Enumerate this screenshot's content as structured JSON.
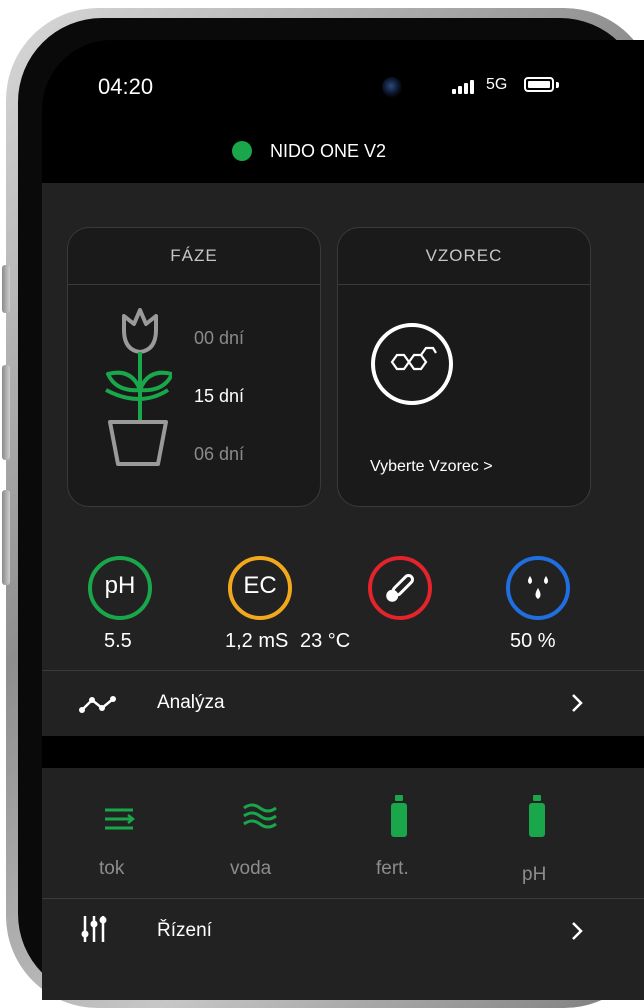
{
  "status_bar": {
    "time": "04:20",
    "network": "5G"
  },
  "device": {
    "name": "NIDO ONE V2",
    "status_color": "#1aa64a"
  },
  "phase_card": {
    "title": "FÁZE",
    "days": [
      "00 dní",
      "15 dní",
      "06 dní"
    ]
  },
  "formula_card": {
    "title": "VZOREC",
    "action": "Vyberte Vzorec >"
  },
  "sensors": [
    {
      "icon": "ph-icon",
      "label": "pH",
      "value": "5.5",
      "color": "#1aa64a"
    },
    {
      "icon": "ec-icon",
      "label": "EC",
      "value": "1,2 mS",
      "color": "#f2a81d"
    },
    {
      "icon": "thermometer-icon",
      "value": "23 °C",
      "color": "#e3242b"
    },
    {
      "icon": "humidity-icon",
      "value": "50 %",
      "color": "#1f6fe0"
    }
  ],
  "analysis": {
    "label": "Analýza"
  },
  "controls": [
    {
      "icon": "flow-icon",
      "label": "tok"
    },
    {
      "icon": "water-icon",
      "label": "voda"
    },
    {
      "icon": "fertilizer-bottle-icon",
      "label": "fert."
    },
    {
      "icon": "ph-bottle-icon",
      "label": "pH"
    }
  ],
  "control_menu": {
    "label": "Řízení"
  },
  "colors": {
    "accent_green": "#1aa64a",
    "panel": "#222222",
    "card": "#1a1a1a",
    "background": "#000000"
  }
}
